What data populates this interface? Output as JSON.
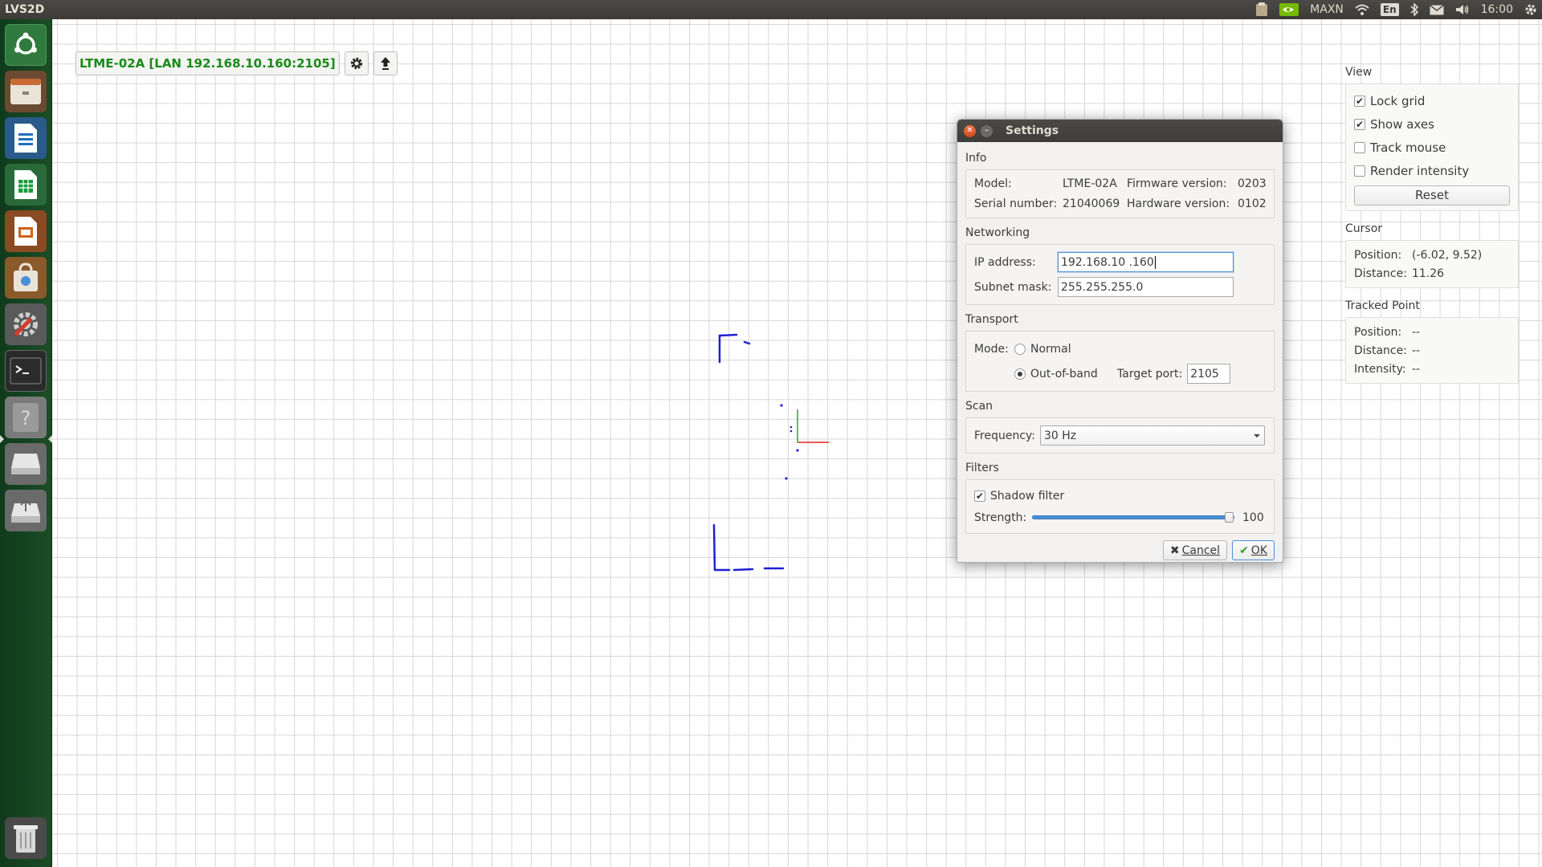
{
  "topbar": {
    "app_title": "LVS2D",
    "gpu_mode": "MAXN",
    "keyboard_layout": "En",
    "clock": "16:00"
  },
  "launcher": {
    "items": [
      {
        "name": "dash-home",
        "icon": "ubuntu-logo-icon"
      },
      {
        "name": "files",
        "icon": "file-manager-icon"
      },
      {
        "name": "writer",
        "icon": "libreoffice-writer-icon"
      },
      {
        "name": "calc",
        "icon": "libreoffice-calc-icon"
      },
      {
        "name": "impress",
        "icon": "libreoffice-impress-icon"
      },
      {
        "name": "software",
        "icon": "software-center-icon"
      },
      {
        "name": "settings",
        "icon": "system-settings-icon"
      },
      {
        "name": "terminal",
        "icon": "terminal-icon"
      },
      {
        "name": "unknown-app",
        "icon": "question-mark-icon"
      },
      {
        "name": "drive",
        "icon": "drive-icon"
      },
      {
        "name": "usb-drive",
        "icon": "usb-drive-icon"
      },
      {
        "name": "trash",
        "icon": "trash-icon"
      }
    ]
  },
  "toolbar": {
    "device_label": "LTME-02A [LAN 192.168.10.160:2105]",
    "settings_icon": "gear-icon",
    "upload_icon": "upload-arrow-icon"
  },
  "side_panel": {
    "view": {
      "title": "View",
      "lock_grid": {
        "label": "Lock grid",
        "checked": true
      },
      "show_axes": {
        "label": "Show axes",
        "checked": true
      },
      "track_mouse": {
        "label": "Track mouse",
        "checked": false
      },
      "render_intensity": {
        "label": "Render intensity",
        "checked": false
      },
      "reset_label": "Reset"
    },
    "cursor": {
      "title": "Cursor",
      "position_label": "Position:",
      "position_value": "(-6.02, 9.52)",
      "distance_label": "Distance:",
      "distance_value": "11.26"
    },
    "tracked_point": {
      "title": "Tracked Point",
      "position_label": "Position:",
      "position_value": "--",
      "distance_label": "Distance:",
      "distance_value": "--",
      "intensity_label": "Intensity:",
      "intensity_value": "--"
    }
  },
  "dialog": {
    "title": "Settings",
    "info": {
      "title": "Info",
      "model_label": "Model:",
      "model_value": "LTME-02A",
      "firmware_label": "Firmware version:",
      "firmware_value": "0203",
      "serial_label": "Serial number:",
      "serial_value": "21040069",
      "hardware_label": "Hardware version:",
      "hardware_value": "0102"
    },
    "networking": {
      "title": "Networking",
      "ip_label": "IP address:",
      "ip_value": "192.168.10 .160",
      "mask_label": "Subnet mask:",
      "mask_value": "255.255.255.0"
    },
    "transport": {
      "title": "Transport",
      "mode_label": "Mode:",
      "normal_label": "Normal",
      "oob_label": "Out-of-band",
      "selected_mode": "Out-of-band",
      "port_label": "Target port:",
      "port_value": "2105"
    },
    "scan": {
      "title": "Scan",
      "frequency_label": "Frequency:",
      "frequency_value": "30 Hz"
    },
    "filters": {
      "title": "Filters",
      "shadow_label": "Shadow filter",
      "shadow_checked": true,
      "strength_label": "Strength:",
      "strength_value": "100",
      "strength_fraction": 1.0
    },
    "cancel_label": "Cancel",
    "ok_label": "OK"
  },
  "colors": {
    "device_label_text": "#1a8a1a",
    "scan_points": "#1f1fd6",
    "axis_x": "#e02020",
    "axis_y": "#20b020",
    "launcher_bg": "#1b4d26",
    "panel_bg": "#3c3b37"
  }
}
